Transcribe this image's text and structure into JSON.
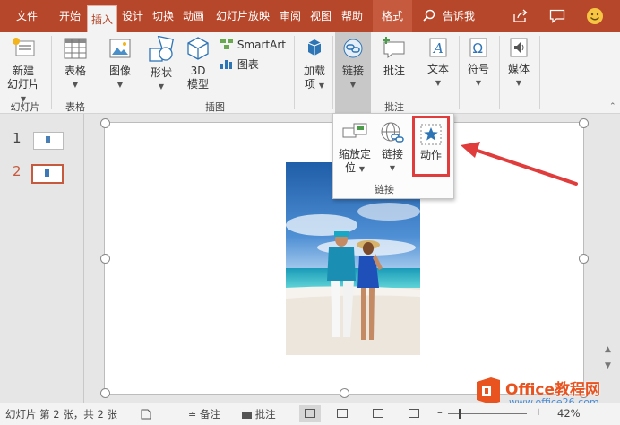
{
  "tabs": [
    {
      "label": "文件"
    },
    {
      "label": "开始"
    },
    {
      "label": "插入"
    },
    {
      "label": "设计"
    },
    {
      "label": "切换"
    },
    {
      "label": "动画"
    },
    {
      "label": "幻灯片放映"
    },
    {
      "label": "审阅"
    },
    {
      "label": "视图"
    },
    {
      "label": "帮助"
    },
    {
      "label": "格式"
    }
  ],
  "tellme": "告诉我",
  "ribbon": {
    "new_slide": [
      "新建",
      "幻灯片"
    ],
    "table": "表格",
    "image": "图像",
    "shapes": "形状",
    "model3d": [
      "3D",
      "模型"
    ],
    "smartart": "SmartArt",
    "chart": "图表",
    "addins": [
      "加载",
      "项"
    ],
    "link": "链接",
    "comment": "批注",
    "text": "文本",
    "symbol": "符号",
    "media": "媒体",
    "groups": {
      "slides": "幻灯片",
      "tables": "表格",
      "illustrations": "插图",
      "comments": "批注"
    }
  },
  "dropdown": {
    "zoom": [
      "缩放定",
      "位"
    ],
    "link": [
      "链接"
    ],
    "action": "动作",
    "group": "链接"
  },
  "slides": [
    {
      "num": "1"
    },
    {
      "num": "2"
    }
  ],
  "status": {
    "slide_info": "幻灯片 第 2 张，共 2 张",
    "notes": "备注",
    "comments": "批注",
    "zoom": "42%"
  },
  "watermark": {
    "brand": "Office教程网",
    "url": "www.office26.com"
  },
  "colors": {
    "accent": "#b7472a",
    "highlight": "#e03c3c",
    "arrow": "#e03c3c"
  }
}
